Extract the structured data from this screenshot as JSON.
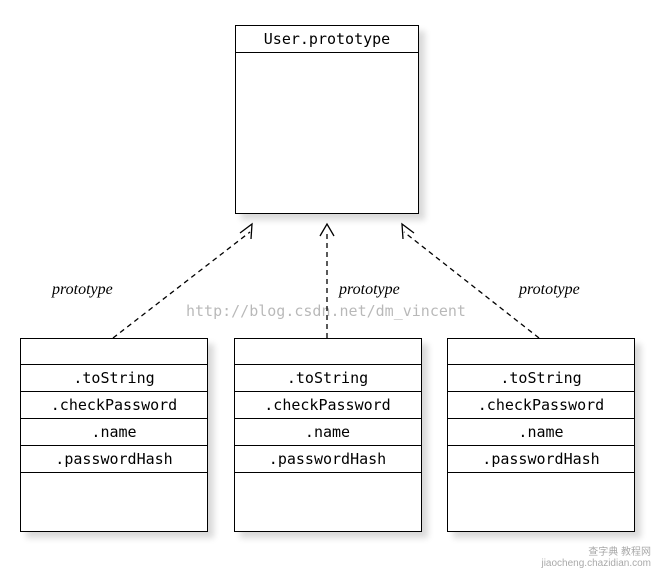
{
  "top_box": {
    "title": "User.prototype"
  },
  "proto_labels": [
    "prototype",
    "prototype",
    "prototype"
  ],
  "objects": [
    {
      "members": [
        ".toString",
        ".checkPassword",
        ".name",
        ".passwordHash"
      ]
    },
    {
      "members": [
        ".toString",
        ".checkPassword",
        ".name",
        ".passwordHash"
      ]
    },
    {
      "members": [
        ".toString",
        ".checkPassword",
        ".name",
        ".passwordHash"
      ]
    }
  ],
  "watermark": "http://blog.csdn.net/dm_vincent",
  "bottom_right": {
    "line1": "查字典 教程网",
    "line2": "jiaocheng.chazidian.com"
  }
}
